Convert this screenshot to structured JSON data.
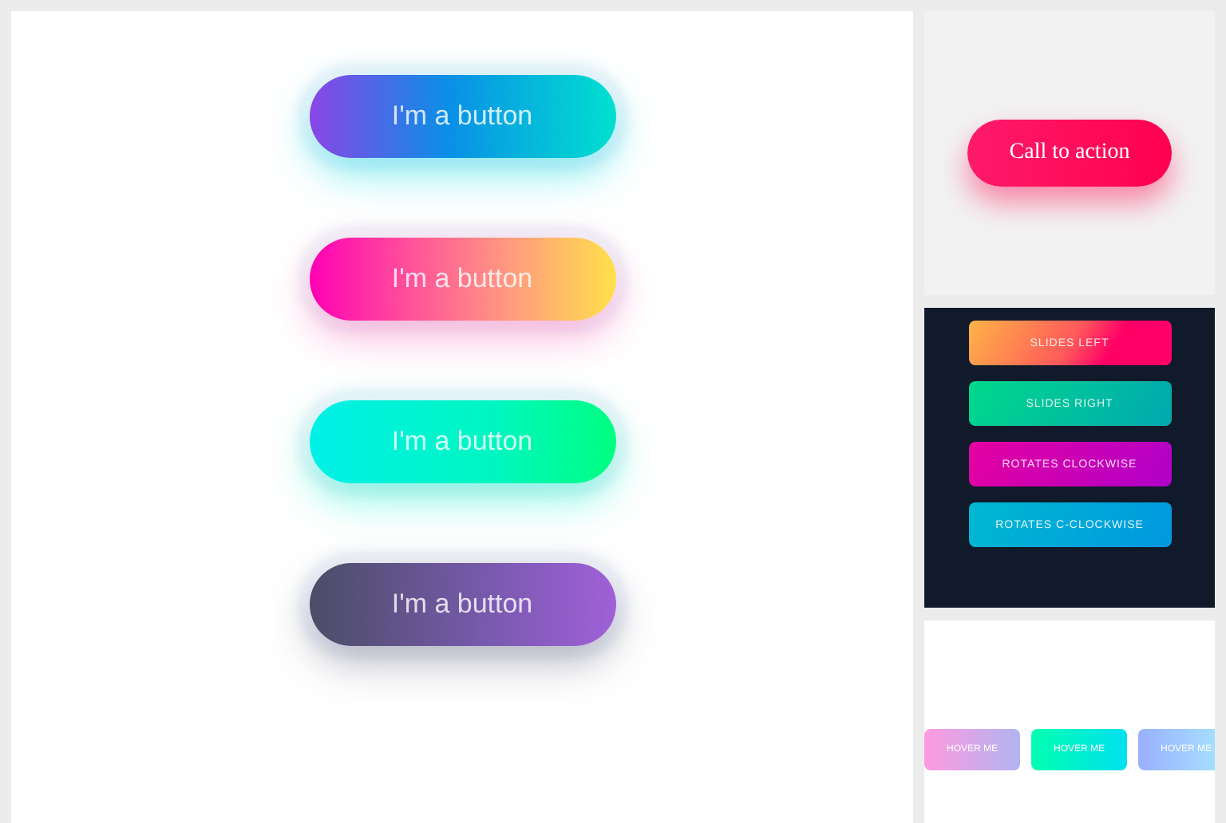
{
  "main_buttons": [
    {
      "label": "I'm a button",
      "kind": "ocean"
    },
    {
      "label": "I'm a button",
      "kind": "sunset"
    },
    {
      "label": "I'm a button",
      "kind": "mint"
    },
    {
      "label": "I'm a button",
      "kind": "dusk"
    }
  ],
  "call_to_action": {
    "label": "Call to action"
  },
  "dark_buttons": [
    {
      "label": "SLIDES LEFT",
      "kind": "orange"
    },
    {
      "label": "SLIDES RIGHT",
      "kind": "teal"
    },
    {
      "label": "ROTATES CLOCKWISE",
      "kind": "magenta"
    },
    {
      "label": "ROTATES C-CLOCKWISE",
      "kind": "cyan"
    }
  ],
  "hover_buttons": [
    {
      "label": "HOVER ME",
      "kind": "pink"
    },
    {
      "label": "HOVER ME",
      "kind": "aqua"
    },
    {
      "label": "HOVER ME",
      "kind": "sky"
    }
  ]
}
